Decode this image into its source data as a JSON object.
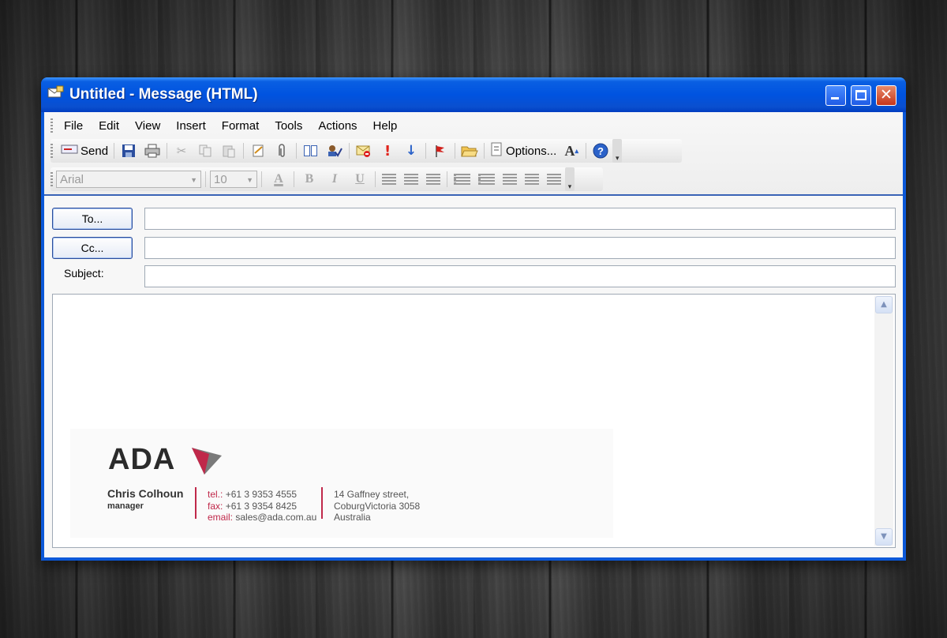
{
  "window": {
    "title": "Untitled - Message (HTML)"
  },
  "menubar": {
    "items": [
      "File",
      "Edit",
      "View",
      "Insert",
      "Format",
      "Tools",
      "Actions",
      "Help"
    ]
  },
  "toolbar": {
    "send_label": "Send",
    "options_label": "Options..."
  },
  "format_toolbar": {
    "font_value": "Arial",
    "size_value": "10",
    "bold": "B",
    "italic": "I",
    "underline": "U",
    "font_color_glyph": "A"
  },
  "header": {
    "to_label": "To...",
    "cc_label": "Cc...",
    "subject_label": "Subject:",
    "to_value": "",
    "cc_value": "",
    "subject_value": ""
  },
  "signature": {
    "logo_text": "ADA",
    "name": "Chris Colhoun",
    "role": "manager",
    "tel_label": "tel.:",
    "tel_value": "+61 3 9353 4555",
    "fax_label": "fax:",
    "fax_value": "+61 3 9354 8425",
    "email_label": "email:",
    "email_value": "sales@ada.com.au",
    "address_line1": "14 Gaffney street,",
    "address_line2": "CoburgVictoria 3058",
    "address_line3": "Australia"
  },
  "colors": {
    "titlebar_blue": "#0053e0",
    "brand_red": "#c0284a",
    "close_red": "#c6361b"
  },
  "icons": [
    "email-app-icon",
    "save-icon",
    "print-icon",
    "cut-icon",
    "copy-icon",
    "paste-icon",
    "insert-file-icon",
    "attach-icon",
    "address-book-icon",
    "check-names-icon",
    "signature-icon",
    "importance-high-icon",
    "importance-low-icon",
    "flag-icon",
    "open-folder-icon",
    "options-icon",
    "font-size-icon",
    "help-icon"
  ]
}
